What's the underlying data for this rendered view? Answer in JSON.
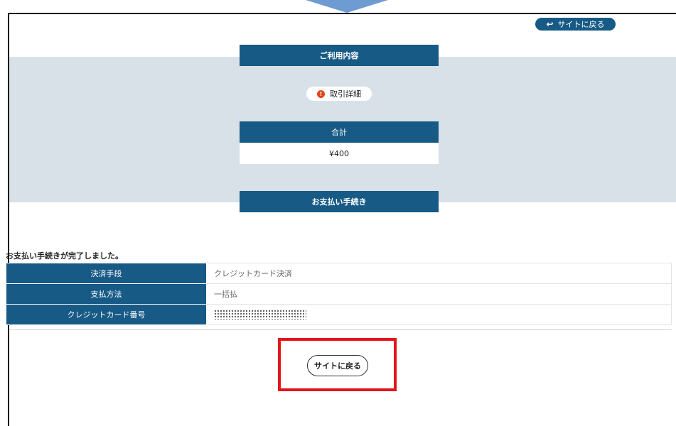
{
  "header": {
    "back_to_site_label": "サイトに戻る"
  },
  "usage": {
    "title": "ご利用内容",
    "detail_label": "取引詳細",
    "total_label": "合計",
    "total_value": "¥400"
  },
  "payment": {
    "title": "お支払い手続き",
    "completed_message": "お支払い手続きが完了しました。",
    "rows": [
      {
        "label": "決済手段",
        "value": "クレジットカード決済"
      },
      {
        "label": "支払方法",
        "value": "一括払"
      },
      {
        "label": "クレジットカード番号",
        "value": ""
      }
    ]
  },
  "footer": {
    "back_to_site_label": "サイトに戻る"
  },
  "colors": {
    "brand_blue": "#175a85",
    "band_gray": "#d9e1e8",
    "highlight_red": "#e3151b",
    "info_orange": "#e2451b",
    "pointer_blue": "#6f9bd3"
  },
  "icons": {
    "return": "return-arrow-icon",
    "info": "info-icon"
  }
}
